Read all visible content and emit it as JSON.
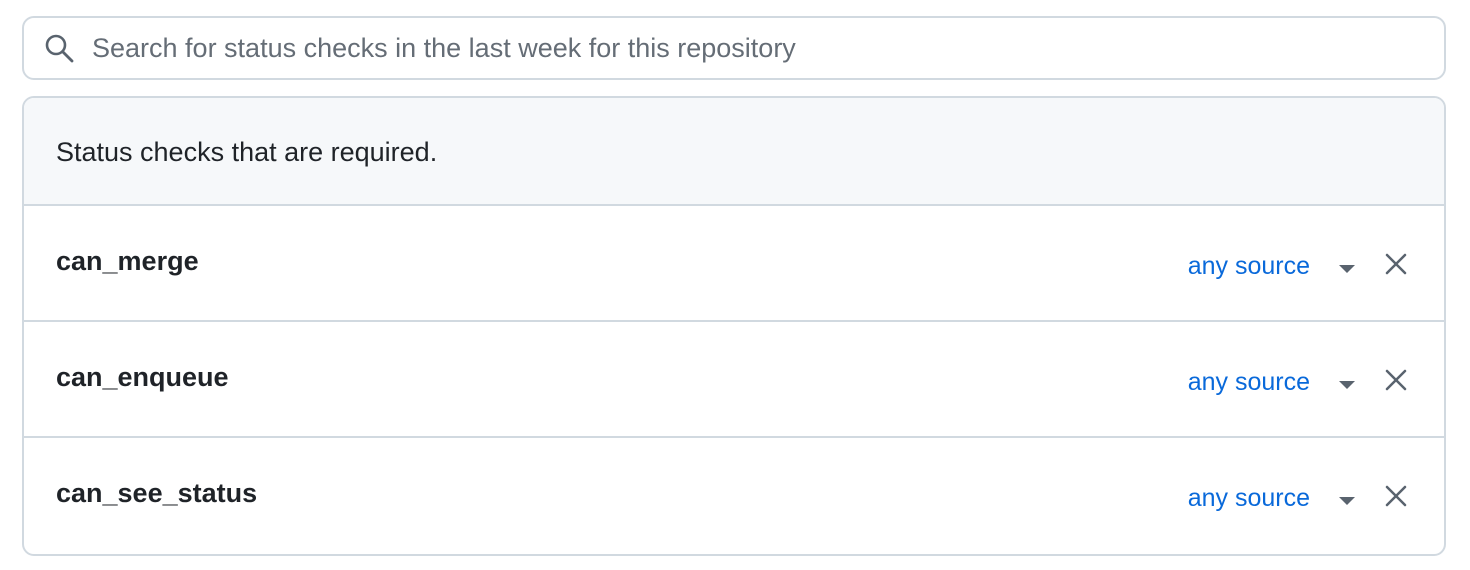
{
  "search": {
    "placeholder": "Search for status checks in the last week for this repository",
    "value": "",
    "icon": "search-icon"
  },
  "panel": {
    "title": "Status checks that are required."
  },
  "checks": [
    {
      "name": "can_merge",
      "source": "any source",
      "dropdown_icon": "chevron-down-icon",
      "remove_icon": "close-icon"
    },
    {
      "name": "can_enqueue",
      "source": "any source",
      "dropdown_icon": "chevron-down-icon",
      "remove_icon": "close-icon"
    },
    {
      "name": "can_see_status",
      "source": "any source",
      "dropdown_icon": "chevron-down-icon",
      "remove_icon": "close-icon"
    }
  ],
  "colors": {
    "border": "#d1d9e0",
    "header_bg": "#f6f8fa",
    "text": "#1f2328",
    "muted": "#656d76",
    "link": "#0969da"
  }
}
